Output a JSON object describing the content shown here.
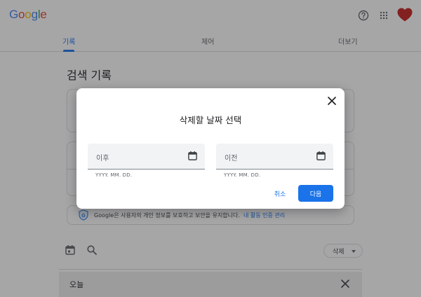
{
  "header": {
    "logo": {
      "letters": [
        "G",
        "o",
        "o",
        "g",
        "l",
        "e"
      ],
      "colors": [
        "#4285F4",
        "#EA4335",
        "#FBBC05",
        "#4285F4",
        "#34A853",
        "#EA4335"
      ]
    },
    "help_icon": "help-circle-icon",
    "apps_icon": "apps-grid-icon",
    "avatar_icon": "heart-avatar-icon"
  },
  "tabs": [
    {
      "label": "기록",
      "active": true
    },
    {
      "label": "제어",
      "active": false
    },
    {
      "label": "더보기",
      "active": false
    }
  ],
  "page": {
    "title": "검색 기록",
    "info_text": "Google은 사용자의 개인 정보를 보호하고 보안을 유지합니다.",
    "info_link": "내 활동 인증 관리",
    "delete_chip": "삭제",
    "today_label": "오늘"
  },
  "dialog": {
    "title": "삭제할 날짜 선택",
    "from_placeholder": "이후",
    "to_placeholder": "이전",
    "from_hint": "YYYY. MM. DD.",
    "to_hint": "YYYY. MM. DD.",
    "cancel_label": "취소",
    "next_label": "다음"
  },
  "colors": {
    "accent": "#1a73e8",
    "avatar": "#c5221f"
  }
}
